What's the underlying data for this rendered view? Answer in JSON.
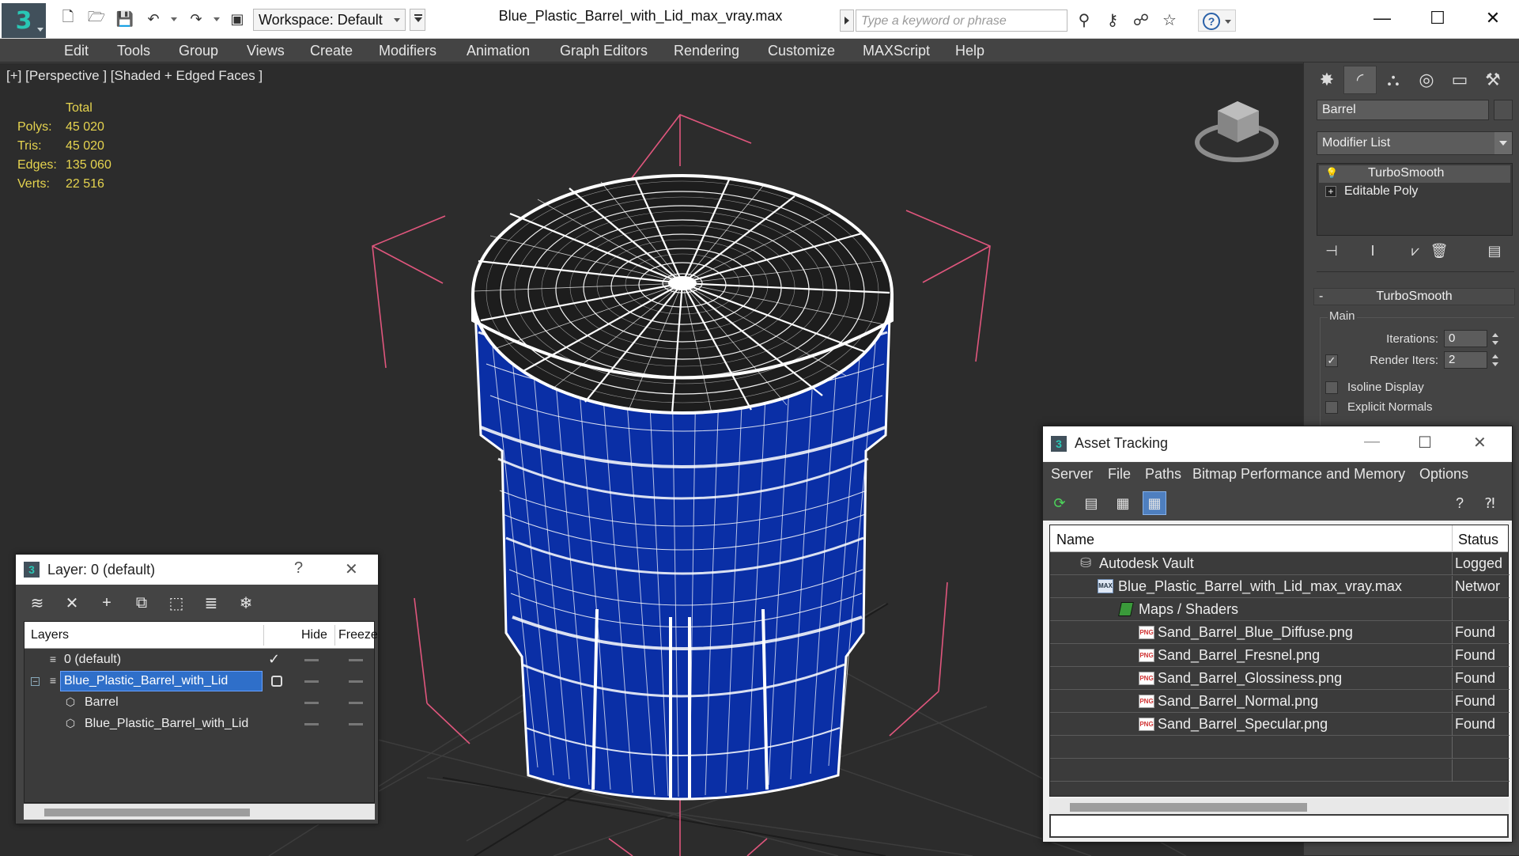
{
  "window": {
    "title": "Blue_Plastic_Barrel_with_Lid_max_vray.max",
    "workspace": "Workspace: Default",
    "search_placeholder": "Type a keyword or phrase",
    "minimize": "—",
    "maximize": "☐",
    "close": "✕"
  },
  "menu": [
    "Edit",
    "Tools",
    "Group",
    "Views",
    "Create",
    "Modifiers",
    "Animation",
    "Graph Editors",
    "Rendering",
    "Customize",
    "MAXScript",
    "Help"
  ],
  "viewport": {
    "label": "[+] [Perspective ] [Shaded + Edged Faces ]",
    "stats": {
      "header": "Total",
      "rows": [
        {
          "label": "Polys:",
          "value": "45 020"
        },
        {
          "label": "Tris:",
          "value": "45 020"
        },
        {
          "label": "Edges:",
          "value": "135 060"
        },
        {
          "label": "Verts:",
          "value": "22 516"
        }
      ]
    },
    "colors": {
      "barrel": "#0a2fa6",
      "wire": "#ffffff",
      "gizmo": "#e0567d",
      "grid": "#3d3d3d"
    }
  },
  "command_panel": {
    "object_name": "Barrel",
    "modifier_list": "Modifier List",
    "stack": [
      {
        "label": "TurboSmooth",
        "icon": "lightbulb-icon"
      },
      {
        "label": "Editable Poly",
        "icon": "plus-icon"
      }
    ],
    "rollout_title": "TurboSmooth",
    "group_main": "Main",
    "iterations_label": "Iterations:",
    "iterations_value": "0",
    "render_iters_label": "Render Iters:",
    "render_iters_value": "2",
    "render_iters_checked": "✓",
    "isoline_label": "Isoline Display",
    "explicit_normals_label": "Explicit Normals"
  },
  "layer_dialog": {
    "title": "Layer: 0 (default)",
    "help": "?",
    "close": "✕",
    "columns": {
      "layers": "Layers",
      "hide": "Hide",
      "freeze": "Freeze"
    },
    "rows": [
      {
        "name": "0 (default)",
        "check": "✓"
      },
      {
        "name": "Blue_Plastic_Barrel_with_Lid",
        "check": ""
      },
      {
        "name": "Barrel",
        "check": ""
      },
      {
        "name": "Blue_Plastic_Barrel_with_Lid",
        "check": ""
      }
    ]
  },
  "asset_tracking": {
    "title": "Asset Tracking",
    "menu": [
      "Server",
      "File",
      "Paths",
      "Bitmap Performance and Memory",
      "Options"
    ],
    "columns": {
      "name": "Name",
      "status": "Status"
    },
    "rows": [
      {
        "name": "Autodesk Vault",
        "status": "Logged"
      },
      {
        "name": "Blue_Plastic_Barrel_with_Lid_max_vray.max",
        "status": "Networ"
      },
      {
        "name": "Maps / Shaders",
        "status": ""
      },
      {
        "name": "Sand_Barrel_Blue_Diffuse.png",
        "status": "Found"
      },
      {
        "name": "Sand_Barrel_Fresnel.png",
        "status": "Found"
      },
      {
        "name": "Sand_Barrel_Glossiness.png",
        "status": "Found"
      },
      {
        "name": "Sand_Barrel_Normal.png",
        "status": "Found"
      },
      {
        "name": "Sand_Barrel_Specular.png",
        "status": "Found"
      }
    ],
    "file_icon_text": "PNG"
  }
}
